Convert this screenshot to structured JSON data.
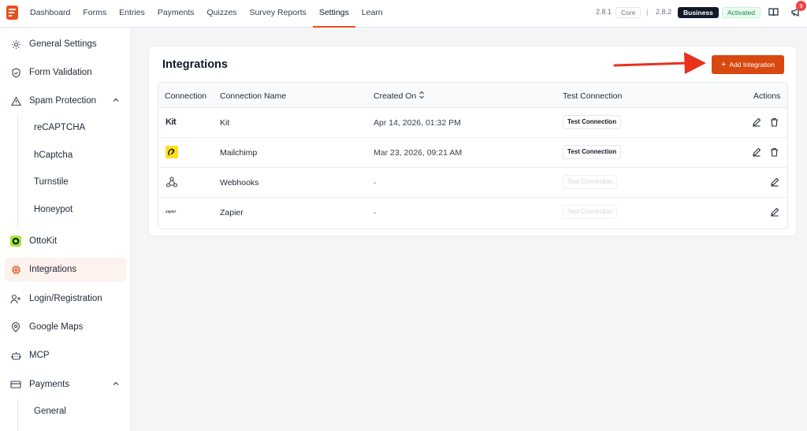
{
  "nav": {
    "items": [
      {
        "label": "Dashboard",
        "active": false
      },
      {
        "label": "Forms",
        "active": false
      },
      {
        "label": "Entries",
        "active": false
      },
      {
        "label": "Payments",
        "active": false
      },
      {
        "label": "Quizzes",
        "active": false
      },
      {
        "label": "Survey Reports",
        "active": false
      },
      {
        "label": "Settings",
        "active": true
      },
      {
        "label": "Learn",
        "active": false
      }
    ],
    "version_core": "2.8.1",
    "core_label": "Core",
    "separator": "|",
    "version_business": "2.8.2",
    "business_label": "Business",
    "status_label": "Activated",
    "notification_count": "9"
  },
  "sidebar": {
    "items": [
      {
        "label": "General Settings",
        "icon": "gear-icon"
      },
      {
        "label": "Form Validation",
        "icon": "shield-check-icon"
      },
      {
        "label": "Spam Protection",
        "icon": "warning-icon",
        "expanded": true
      },
      {
        "label": "OttoKit",
        "icon": "ottokit-icon"
      },
      {
        "label": "Integrations",
        "icon": "integrations-icon",
        "active": true
      },
      {
        "label": "Login/Registration",
        "icon": "user-plus-icon"
      },
      {
        "label": "Google Maps",
        "icon": "map-pin-icon"
      },
      {
        "label": "MCP",
        "icon": "robot-icon"
      },
      {
        "label": "Payments",
        "icon": "card-icon",
        "expanded": true
      }
    ],
    "spam_sub": [
      "reCAPTCHA",
      "hCaptcha",
      "Turnstile",
      "Honeypot"
    ],
    "payments_sub": [
      "General"
    ]
  },
  "main": {
    "title": "Integrations",
    "add_button": "Add Integration",
    "columns": [
      "Connection",
      "Connection Name",
      "Created On",
      "Test Connection",
      "Actions"
    ],
    "rows": [
      {
        "logo": "kit-logo",
        "logo_text": "Kit",
        "name": "Kit",
        "created": "Apr 14, 2026, 01:32 PM",
        "test": "Test Connection",
        "test_enabled": true,
        "deletable": true
      },
      {
        "logo": "mailchimp-logo",
        "name": "Mailchimp",
        "created": "Mar 23, 2026, 09:21 AM",
        "test": "Test Connection",
        "test_enabled": true,
        "deletable": true
      },
      {
        "logo": "webhooks-icon",
        "name": "Webhooks",
        "created": "-",
        "test": "Test Connection",
        "test_enabled": false,
        "deletable": false
      },
      {
        "logo": "zapier-logo",
        "logo_text": "zapier",
        "name": "Zapier",
        "created": "-",
        "test": "Test Connection",
        "test_enabled": false,
        "deletable": false
      }
    ]
  },
  "colors": {
    "accent": "#d9480f",
    "annotation_arrow": "#e8321c"
  }
}
